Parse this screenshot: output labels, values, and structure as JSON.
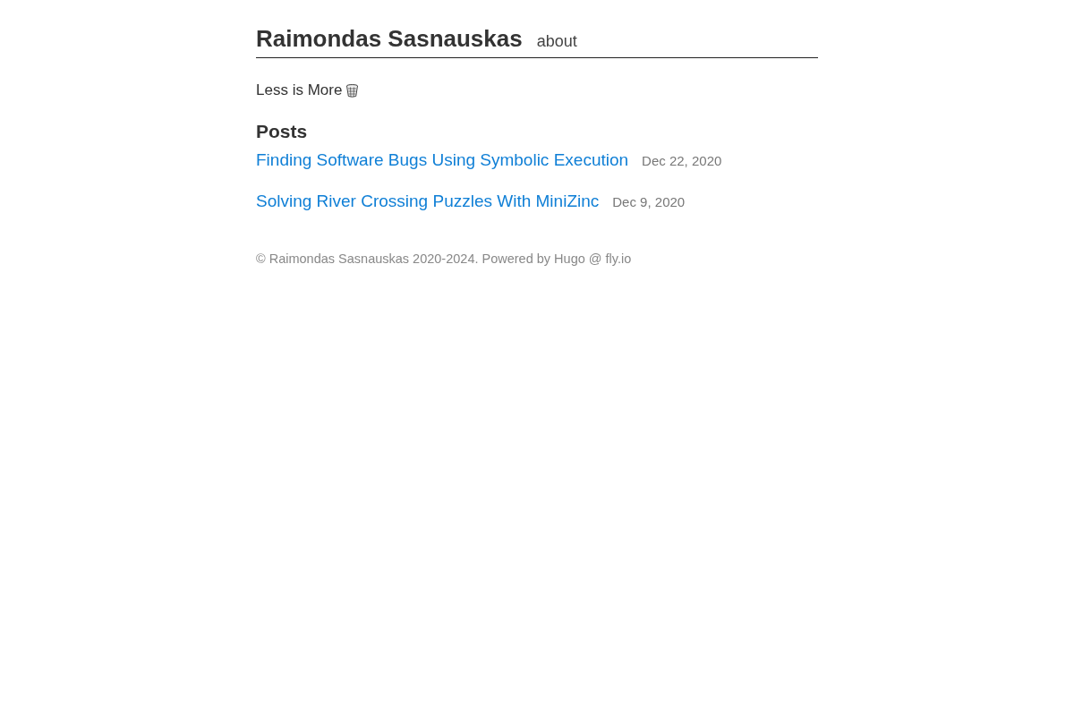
{
  "header": {
    "title": "Raimondas Sasnauskas",
    "nav": [
      {
        "label": "about"
      }
    ]
  },
  "tagline": {
    "text": "Less is More"
  },
  "posts": {
    "heading": "Posts",
    "items": [
      {
        "title": "Finding Software Bugs Using Symbolic Execution",
        "date": "Dec 22, 2020"
      },
      {
        "title": "Solving River Crossing Puzzles With MiniZinc",
        "date": "Dec 9, 2020"
      }
    ]
  },
  "footer": {
    "text": "© Raimondas Sasnauskas 2020-2024. Powered by Hugo @ fly.io"
  }
}
